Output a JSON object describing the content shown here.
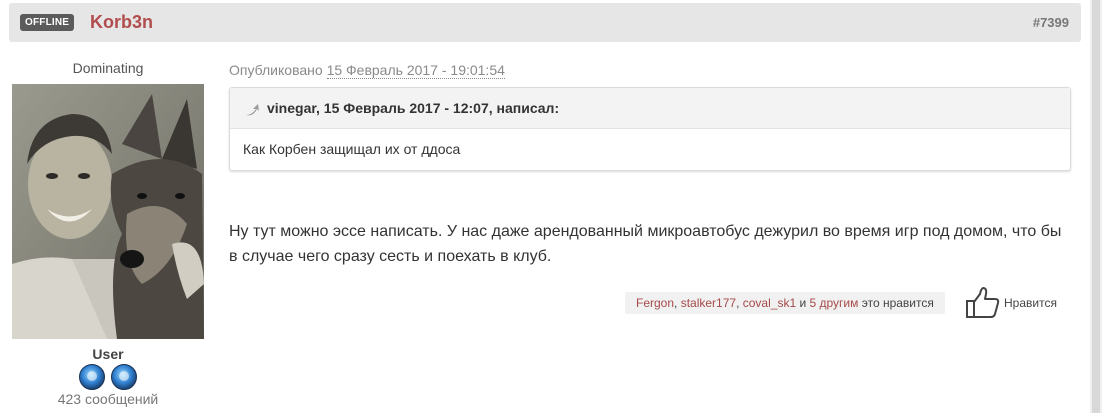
{
  "header": {
    "status_badge": "OFFLINE",
    "author": "Korb3n",
    "post_number": "#7399"
  },
  "user": {
    "title": "Dominating",
    "group": "User",
    "post_count": "423 сообщений",
    "badge_icons": [
      "rank-badge-icon",
      "rank-badge-icon"
    ]
  },
  "post": {
    "published_prefix": "Опубликовано",
    "published_date": "15 Февраль 2017 - 19:01:54",
    "quote": {
      "citation": "vinegar, 15 Февраль 2017 - 12:07, написал:",
      "text": "Как Корбен защищал их от ддоса"
    },
    "content": "Ну тут можно эссе написать. У нас даже арендованный микроавтобус дежурил во время игр под домом, что бы в случае чего сразу сесть и поехать в клуб."
  },
  "likes": {
    "likers": [
      "Fergon",
      "stalker177",
      "coval_sk1"
    ],
    "sep_comma": ", ",
    "sep_and": " и ",
    "others": "5 другим",
    "suffix": " это нравится",
    "button_label": "Нравится"
  },
  "colors": {
    "author": "#b24d4d",
    "header_bg": "#e6e6e6",
    "badge_bg": "#5b5b5b",
    "link": "#a64a4a"
  }
}
